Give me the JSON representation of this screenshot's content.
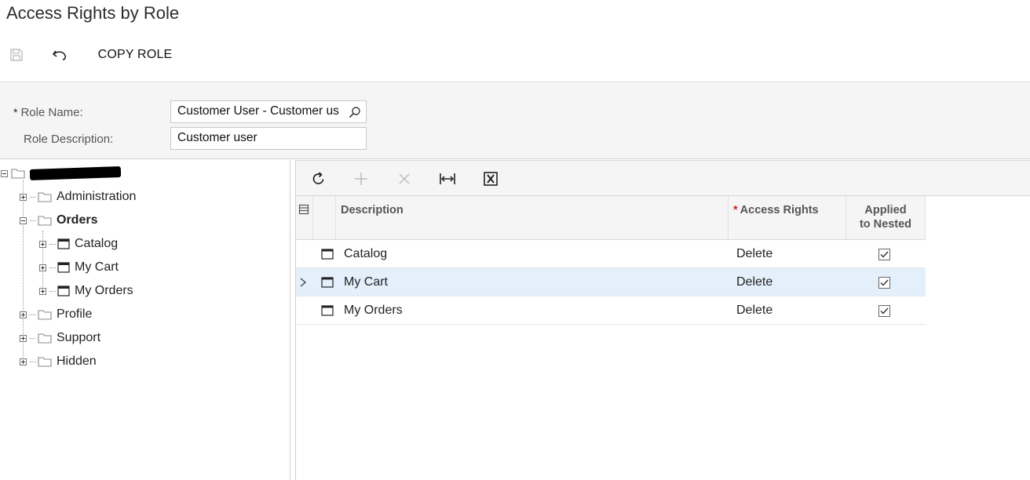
{
  "page": {
    "title": "Access Rights by Role"
  },
  "toolbar": {
    "copy_role_label": "COPY ROLE"
  },
  "form": {
    "role_name_label": "Role Name:",
    "role_name_value": "Customer User - Customer us",
    "role_description_label": "Role Description:",
    "role_description_value": "Customer user"
  },
  "tree": {
    "items": [
      {
        "label": "Administration"
      },
      {
        "label": "Orders"
      },
      {
        "label": "Catalog"
      },
      {
        "label": "My Cart"
      },
      {
        "label": "My Orders"
      },
      {
        "label": "Profile"
      },
      {
        "label": "Support"
      },
      {
        "label": "Hidden"
      }
    ]
  },
  "grid": {
    "columns": {
      "description": "Description",
      "access_rights": "Access Rights",
      "applied_line1": "Applied",
      "applied_line2": "to Nested"
    },
    "rows": [
      {
        "description": "Catalog",
        "access_rights": "Delete",
        "applied": true
      },
      {
        "description": "My Cart",
        "access_rights": "Delete",
        "applied": true
      },
      {
        "description": "My Orders",
        "access_rights": "Delete",
        "applied": true
      }
    ]
  },
  "colors": {
    "selected_row": "#e3f0fb",
    "required_star": "#d9231e"
  }
}
